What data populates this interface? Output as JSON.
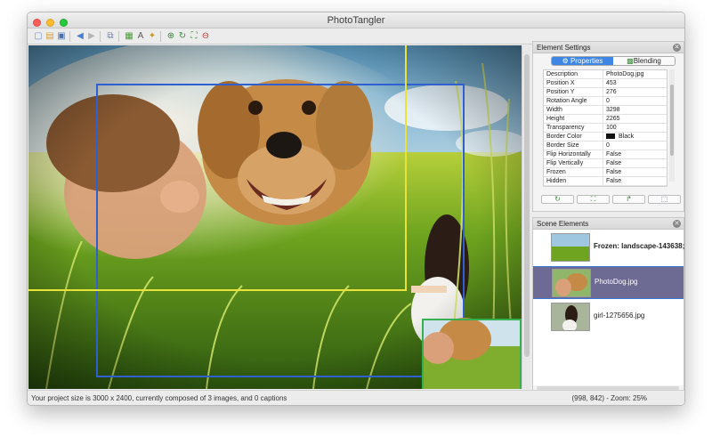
{
  "window": {
    "title": "PhotoTangler"
  },
  "toolbar": {
    "icons": [
      "new-project-icon",
      "open-project-icon",
      "save-project-icon",
      "undo-icon",
      "redo-icon",
      "copy-icon",
      "add-image-icon",
      "add-text-icon",
      "add-effect-icon",
      "zoom-in-icon",
      "rotate-icon",
      "fit-icon",
      "zoom-out-icon"
    ]
  },
  "status": {
    "info": "Your project size is 3000 x 2400, currently composed of 3 images, and 0 captions",
    "coords": "(998, 842) - Zoom: 25%"
  },
  "element_settings": {
    "title": "Element Settings",
    "tabs": [
      "Properties",
      "Blending"
    ],
    "active_tab": "Properties",
    "properties": [
      {
        "key": "Description",
        "value": "PhotoDog.jpg"
      },
      {
        "key": "Position X",
        "value": "453"
      },
      {
        "key": "Position Y",
        "value": "276"
      },
      {
        "key": "Rotation Angle",
        "value": "0"
      },
      {
        "key": "Width",
        "value": "3298"
      },
      {
        "key": "Height",
        "value": "2265"
      },
      {
        "key": "Transparency",
        "value": "100"
      },
      {
        "key": "Border Color",
        "value": "Black"
      },
      {
        "key": "Border Size",
        "value": "0"
      },
      {
        "key": "Flip Horizontally",
        "value": "False"
      },
      {
        "key": "Flip Vertically",
        "value": "False"
      },
      {
        "key": "Frozen",
        "value": "False"
      },
      {
        "key": "Hidden",
        "value": "False"
      }
    ],
    "buttons": [
      "refresh-icon",
      "fit-icon",
      "rotate-icon",
      "crop-icon"
    ]
  },
  "scene_elements": {
    "title": "Scene Elements",
    "items": [
      {
        "label": "Frozen: landscape-143638;",
        "selected": false,
        "bold": true
      },
      {
        "label": "PhotoDog.jpg",
        "selected": true,
        "bold": false
      },
      {
        "label": "girl-1275656.jpg",
        "selected": false,
        "bold": false
      }
    ],
    "buttons": [
      "move-up-icon",
      "move-down-icon",
      "anchor-icon",
      "delete-icon"
    ]
  },
  "colors": {
    "selection_accent": "#3b77d4",
    "selected_row_bg": "#6d6a94",
    "yellow_bounds": "#e8e23a",
    "blue_bounds": "#2f5fd0",
    "green_bounds": "#35b050"
  }
}
